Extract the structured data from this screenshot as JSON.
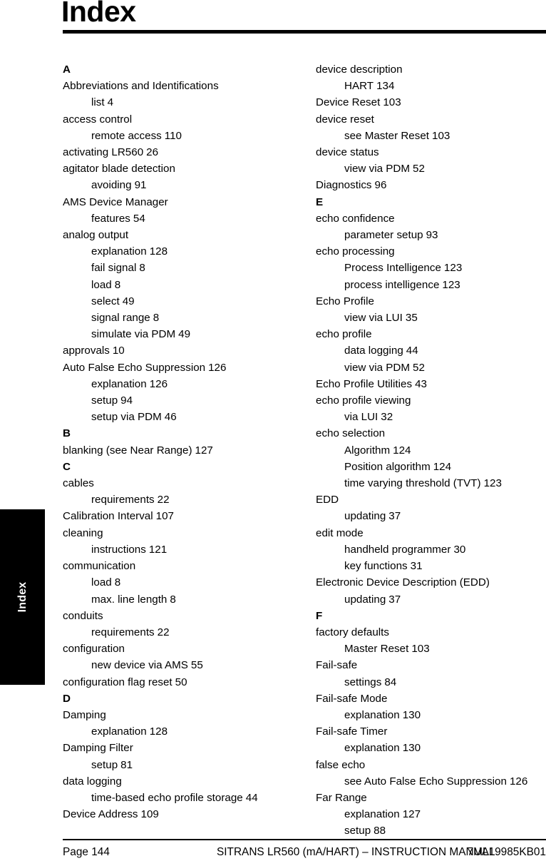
{
  "page": {
    "title": "Index",
    "thumb_tab_label": "Index"
  },
  "footer": {
    "page_label": "Page 144",
    "manual_title": "SITRANS LR560 (mA/HART) – INSTRUCTION MANUAL",
    "part_number": "7ML19985KB01"
  },
  "columns": [
    {
      "id": "left",
      "blocks": [
        {
          "type": "letter",
          "text": "A"
        },
        {
          "type": "entry",
          "text": "Abbreviations and Identifications"
        },
        {
          "type": "sub",
          "text": "list",
          "page": "4"
        },
        {
          "type": "entry",
          "text": "access control"
        },
        {
          "type": "sub",
          "text": "remote access",
          "page": "110"
        },
        {
          "type": "entry",
          "text": "activating LR560",
          "page": "26"
        },
        {
          "type": "entry",
          "text": "agitator blade detection"
        },
        {
          "type": "sub",
          "text": "avoiding",
          "page": "91"
        },
        {
          "type": "entry",
          "text": "AMS Device Manager"
        },
        {
          "type": "sub",
          "text": "features",
          "page": "54"
        },
        {
          "type": "entry",
          "text": "analog output"
        },
        {
          "type": "sub",
          "text": "explanation",
          "page": "128"
        },
        {
          "type": "sub",
          "text": "fail signal",
          "page": "8"
        },
        {
          "type": "sub",
          "text": "load",
          "page": "8"
        },
        {
          "type": "sub",
          "text": "select",
          "page": "49"
        },
        {
          "type": "sub",
          "text": "signal range",
          "page": "8"
        },
        {
          "type": "sub",
          "text": "simulate via PDM",
          "page": "49"
        },
        {
          "type": "entry",
          "text": "approvals",
          "page": "10"
        },
        {
          "type": "entry",
          "text": "Auto False Echo Suppression",
          "page": "126"
        },
        {
          "type": "sub",
          "text": "explanation",
          "page": "126"
        },
        {
          "type": "sub",
          "text": "setup",
          "page": "94"
        },
        {
          "type": "sub",
          "text": "setup via PDM",
          "page": "46"
        },
        {
          "type": "letter",
          "text": "B"
        },
        {
          "type": "entry",
          "text": "blanking (see Near Range)",
          "page": "127"
        },
        {
          "type": "letter",
          "text": "C"
        },
        {
          "type": "entry",
          "text": "cables"
        },
        {
          "type": "sub",
          "text": "requirements",
          "page": "22"
        },
        {
          "type": "entry",
          "text": "Calibration Interval",
          "page": "107"
        },
        {
          "type": "entry",
          "text": "cleaning"
        },
        {
          "type": "sub",
          "text": "instructions",
          "page": "121"
        },
        {
          "type": "entry",
          "text": "communication"
        },
        {
          "type": "sub",
          "text": "load",
          "page": "8"
        },
        {
          "type": "sub",
          "text": "max. line length",
          "page": "8"
        },
        {
          "type": "entry",
          "text": "conduits"
        },
        {
          "type": "sub",
          "text": "requirements",
          "page": "22"
        },
        {
          "type": "entry",
          "text": "configuration"
        },
        {
          "type": "sub",
          "text": "new device via AMS",
          "page": "55"
        },
        {
          "type": "entry",
          "text": "configuration flag reset",
          "page": "50"
        },
        {
          "type": "letter",
          "text": "D"
        },
        {
          "type": "entry",
          "text": "Damping"
        },
        {
          "type": "sub",
          "text": "explanation",
          "page": "128"
        },
        {
          "type": "entry",
          "text": "Damping Filter"
        },
        {
          "type": "sub",
          "text": "setup",
          "page": "81"
        },
        {
          "type": "entry",
          "text": "data logging"
        },
        {
          "type": "sub",
          "text": "time-based echo profile storage",
          "page": "44"
        },
        {
          "type": "entry",
          "text": "Device Address",
          "page": "109"
        }
      ]
    },
    {
      "id": "right",
      "blocks": [
        {
          "type": "entry",
          "text": "device description"
        },
        {
          "type": "sub",
          "text": "HART",
          "page": "134"
        },
        {
          "type": "entry",
          "text": "Device Reset",
          "page": "103"
        },
        {
          "type": "entry",
          "text": "device reset"
        },
        {
          "type": "sub",
          "text": "see Master Reset",
          "page": "103"
        },
        {
          "type": "entry",
          "text": "device status"
        },
        {
          "type": "sub",
          "text": "view via PDM",
          "page": "52"
        },
        {
          "type": "entry",
          "text": "Diagnostics",
          "page": "96"
        },
        {
          "type": "letter",
          "text": "E"
        },
        {
          "type": "entry",
          "text": "echo confidence"
        },
        {
          "type": "sub",
          "text": "parameter setup",
          "page": "93"
        },
        {
          "type": "entry",
          "text": "echo processing"
        },
        {
          "type": "sub",
          "text": "Process Intelligence",
          "page": "123"
        },
        {
          "type": "sub",
          "text": "process intelligence",
          "page": "123"
        },
        {
          "type": "entry",
          "text": "Echo Profile"
        },
        {
          "type": "sub",
          "text": "view via LUI",
          "page": "35"
        },
        {
          "type": "entry",
          "text": "echo profile"
        },
        {
          "type": "sub",
          "text": "data logging",
          "page": "44"
        },
        {
          "type": "sub",
          "text": "view via PDM",
          "page": "52"
        },
        {
          "type": "entry",
          "text": "Echo Profile Utilities",
          "page": "43"
        },
        {
          "type": "entry",
          "text": "echo profile viewing"
        },
        {
          "type": "sub",
          "text": "via LUI",
          "page": "32"
        },
        {
          "type": "entry",
          "text": "echo selection"
        },
        {
          "type": "sub",
          "text": "Algorithm",
          "page": "124"
        },
        {
          "type": "sub",
          "text": "Position algorithm",
          "page": "124"
        },
        {
          "type": "sub",
          "text": "time varying threshold (TVT)",
          "page": "123"
        },
        {
          "type": "entry",
          "text": "EDD"
        },
        {
          "type": "sub",
          "text": "updating",
          "page": "37"
        },
        {
          "type": "entry",
          "text": "edit mode"
        },
        {
          "type": "sub",
          "text": "handheld programmer",
          "page": "30"
        },
        {
          "type": "sub",
          "text": "key functions",
          "page": "31"
        },
        {
          "type": "entry",
          "text": "Electronic Device Description (EDD)"
        },
        {
          "type": "sub",
          "text": "updating",
          "page": "37"
        },
        {
          "type": "letter",
          "text": "F"
        },
        {
          "type": "entry",
          "text": "factory defaults"
        },
        {
          "type": "sub",
          "text": "Master Reset",
          "page": "103"
        },
        {
          "type": "entry",
          "text": "Fail-safe"
        },
        {
          "type": "sub",
          "text": "settings",
          "page": "84"
        },
        {
          "type": "entry",
          "text": "Fail-safe Mode"
        },
        {
          "type": "sub",
          "text": "explanation",
          "page": "130"
        },
        {
          "type": "entry",
          "text": "Fail-safe Timer"
        },
        {
          "type": "sub",
          "text": "explanation",
          "page": "130"
        },
        {
          "type": "entry",
          "text": "false echo"
        },
        {
          "type": "sub",
          "text": "see Auto False Echo Suppression",
          "page": "126"
        },
        {
          "type": "entry",
          "text": "Far Range"
        },
        {
          "type": "sub",
          "text": "explanation",
          "page": "127"
        },
        {
          "type": "sub",
          "text": "setup",
          "page": "88"
        }
      ]
    }
  ]
}
